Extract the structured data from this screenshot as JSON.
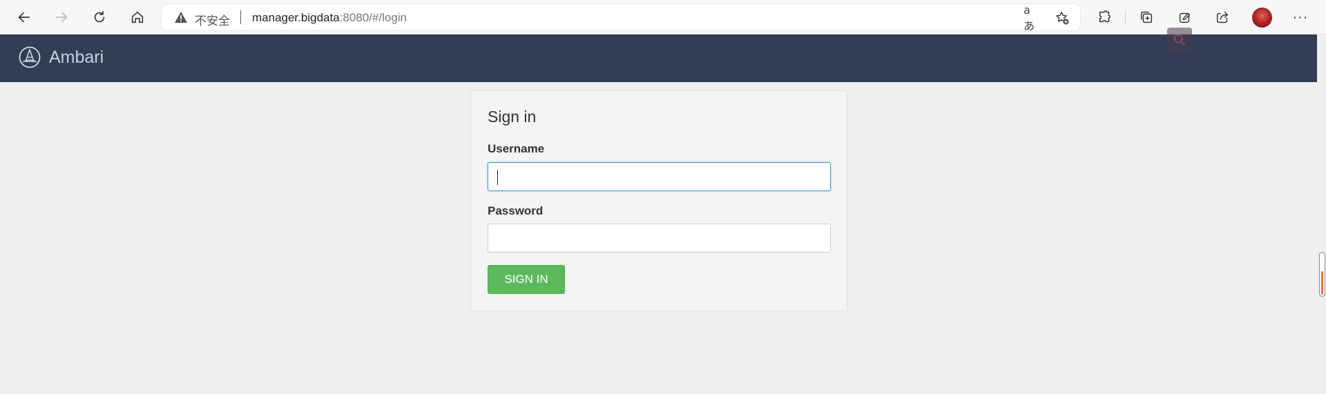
{
  "browser": {
    "insecure_label": "不安全",
    "url_host": "manager.bigdata",
    "url_path": ":8080/#/login",
    "translate_glyph": "aあ",
    "more_glyph": "···"
  },
  "app": {
    "title": "Ambari"
  },
  "login": {
    "heading": "Sign in",
    "username_label": "Username",
    "username_value": "",
    "password_label": "Password",
    "password_value": "",
    "signin_label": "SIGN IN"
  },
  "colors": {
    "header_bg": "#323e55",
    "signin_green": "#5cb85c",
    "focus_border": "#3e9bc6"
  }
}
